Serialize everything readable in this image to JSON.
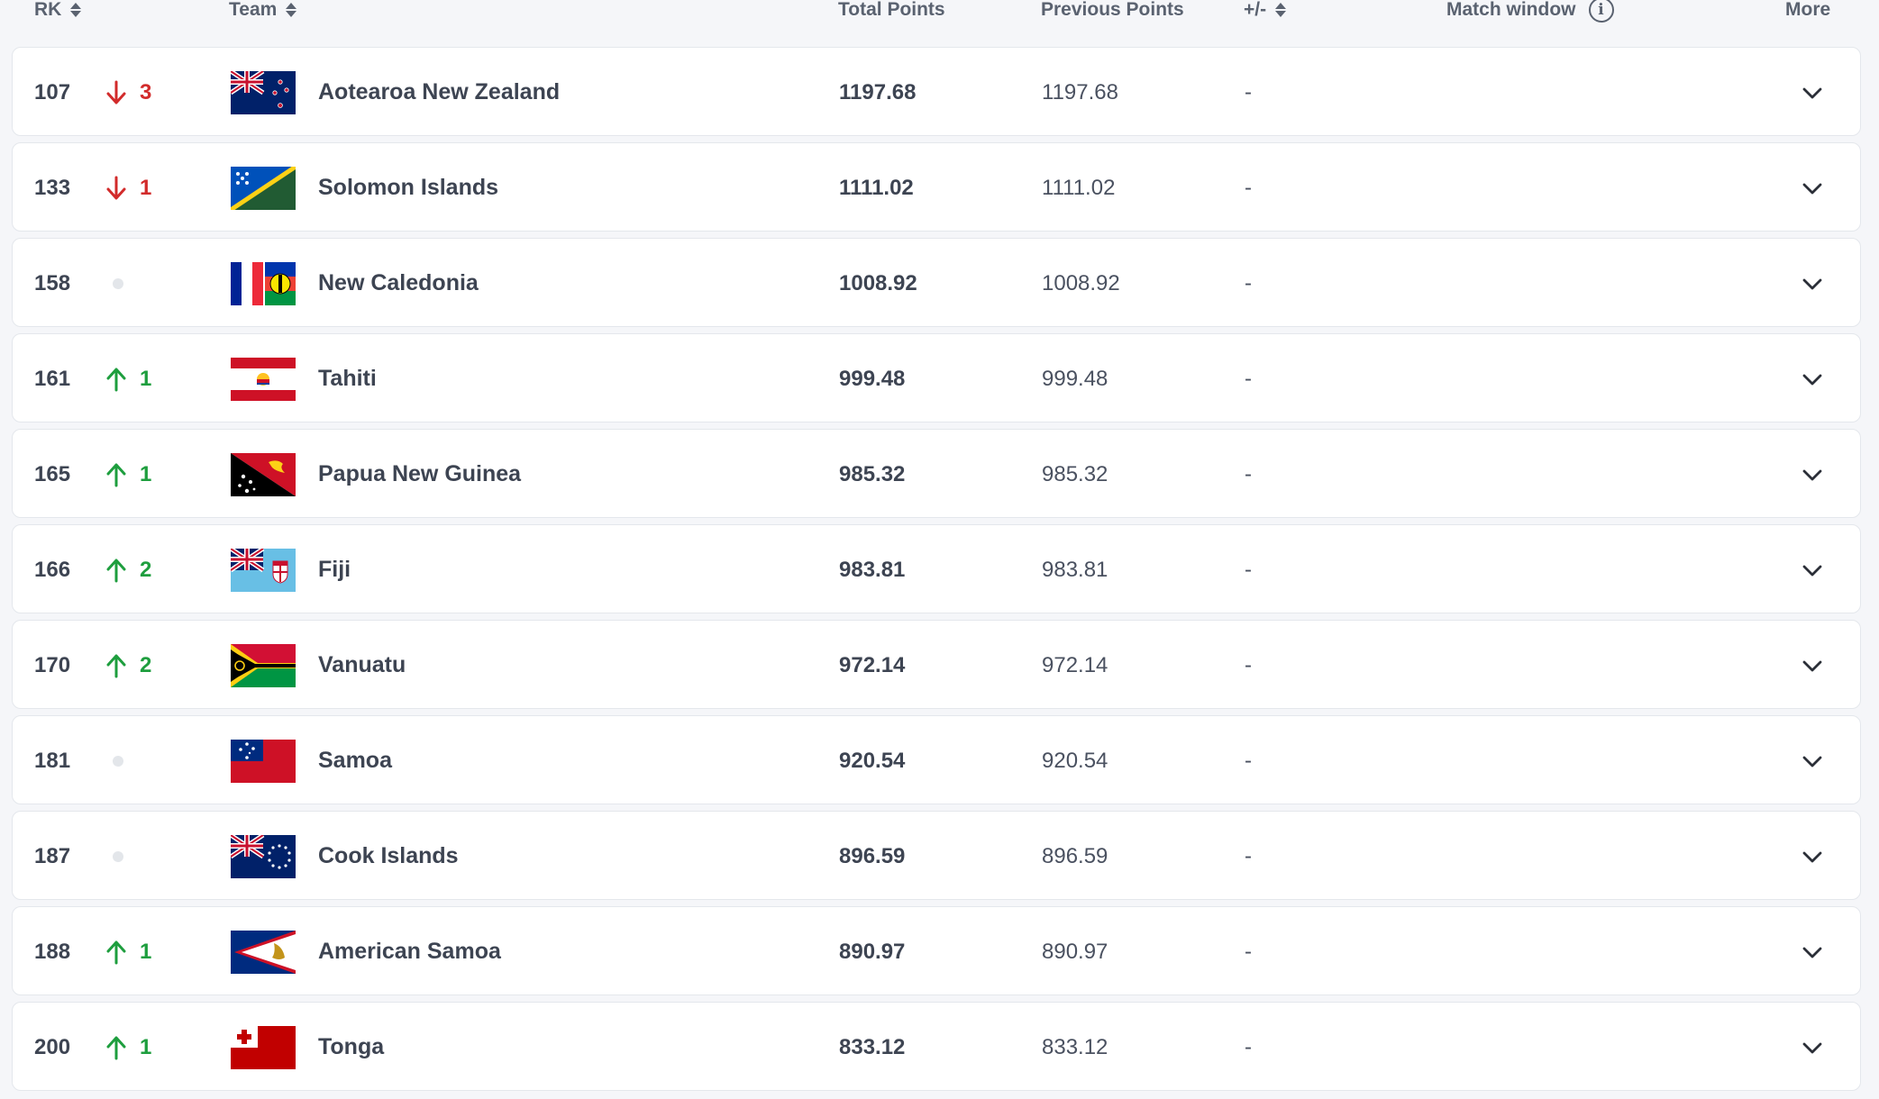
{
  "header": {
    "rk": "RK",
    "team": "Team",
    "total_points": "Total Points",
    "previous_points": "Previous Points",
    "plus_minus": "+/-",
    "match_window": "Match window",
    "more": "More"
  },
  "rows": [
    {
      "rank": "107",
      "move": "3",
      "dir": "down",
      "team": "Aotearoa New Zealand",
      "flag": "nz",
      "total": "1197.68",
      "prev": "1197.68",
      "diff": "-"
    },
    {
      "rank": "133",
      "move": "1",
      "dir": "down",
      "team": "Solomon Islands",
      "flag": "sol",
      "total": "1111.02",
      "prev": "1111.02",
      "diff": "-"
    },
    {
      "rank": "158",
      "move": "",
      "dir": "none",
      "team": "New Caledonia",
      "flag": "ncl",
      "total": "1008.92",
      "prev": "1008.92",
      "diff": "-"
    },
    {
      "rank": "161",
      "move": "1",
      "dir": "up",
      "team": "Tahiti",
      "flag": "tah",
      "total": "999.48",
      "prev": "999.48",
      "diff": "-"
    },
    {
      "rank": "165",
      "move": "1",
      "dir": "up",
      "team": "Papua New Guinea",
      "flag": "png",
      "total": "985.32",
      "prev": "985.32",
      "diff": "-"
    },
    {
      "rank": "166",
      "move": "2",
      "dir": "up",
      "team": "Fiji",
      "flag": "fij",
      "total": "983.81",
      "prev": "983.81",
      "diff": "-"
    },
    {
      "rank": "170",
      "move": "2",
      "dir": "up",
      "team": "Vanuatu",
      "flag": "van",
      "total": "972.14",
      "prev": "972.14",
      "diff": "-"
    },
    {
      "rank": "181",
      "move": "",
      "dir": "none",
      "team": "Samoa",
      "flag": "sam",
      "total": "920.54",
      "prev": "920.54",
      "diff": "-"
    },
    {
      "rank": "187",
      "move": "",
      "dir": "none",
      "team": "Cook Islands",
      "flag": "cok",
      "total": "896.59",
      "prev": "896.59",
      "diff": "-"
    },
    {
      "rank": "188",
      "move": "1",
      "dir": "up",
      "team": "American Samoa",
      "flag": "asa",
      "total": "890.97",
      "prev": "890.97",
      "diff": "-"
    },
    {
      "rank": "200",
      "move": "1",
      "dir": "up",
      "team": "Tonga",
      "flag": "tga",
      "total": "833.12",
      "prev": "833.12",
      "diff": "-"
    }
  ],
  "colors": {
    "up": "#1e9e3e",
    "down": "#d22b2b",
    "neutral_dot": "#e3e6ea"
  }
}
